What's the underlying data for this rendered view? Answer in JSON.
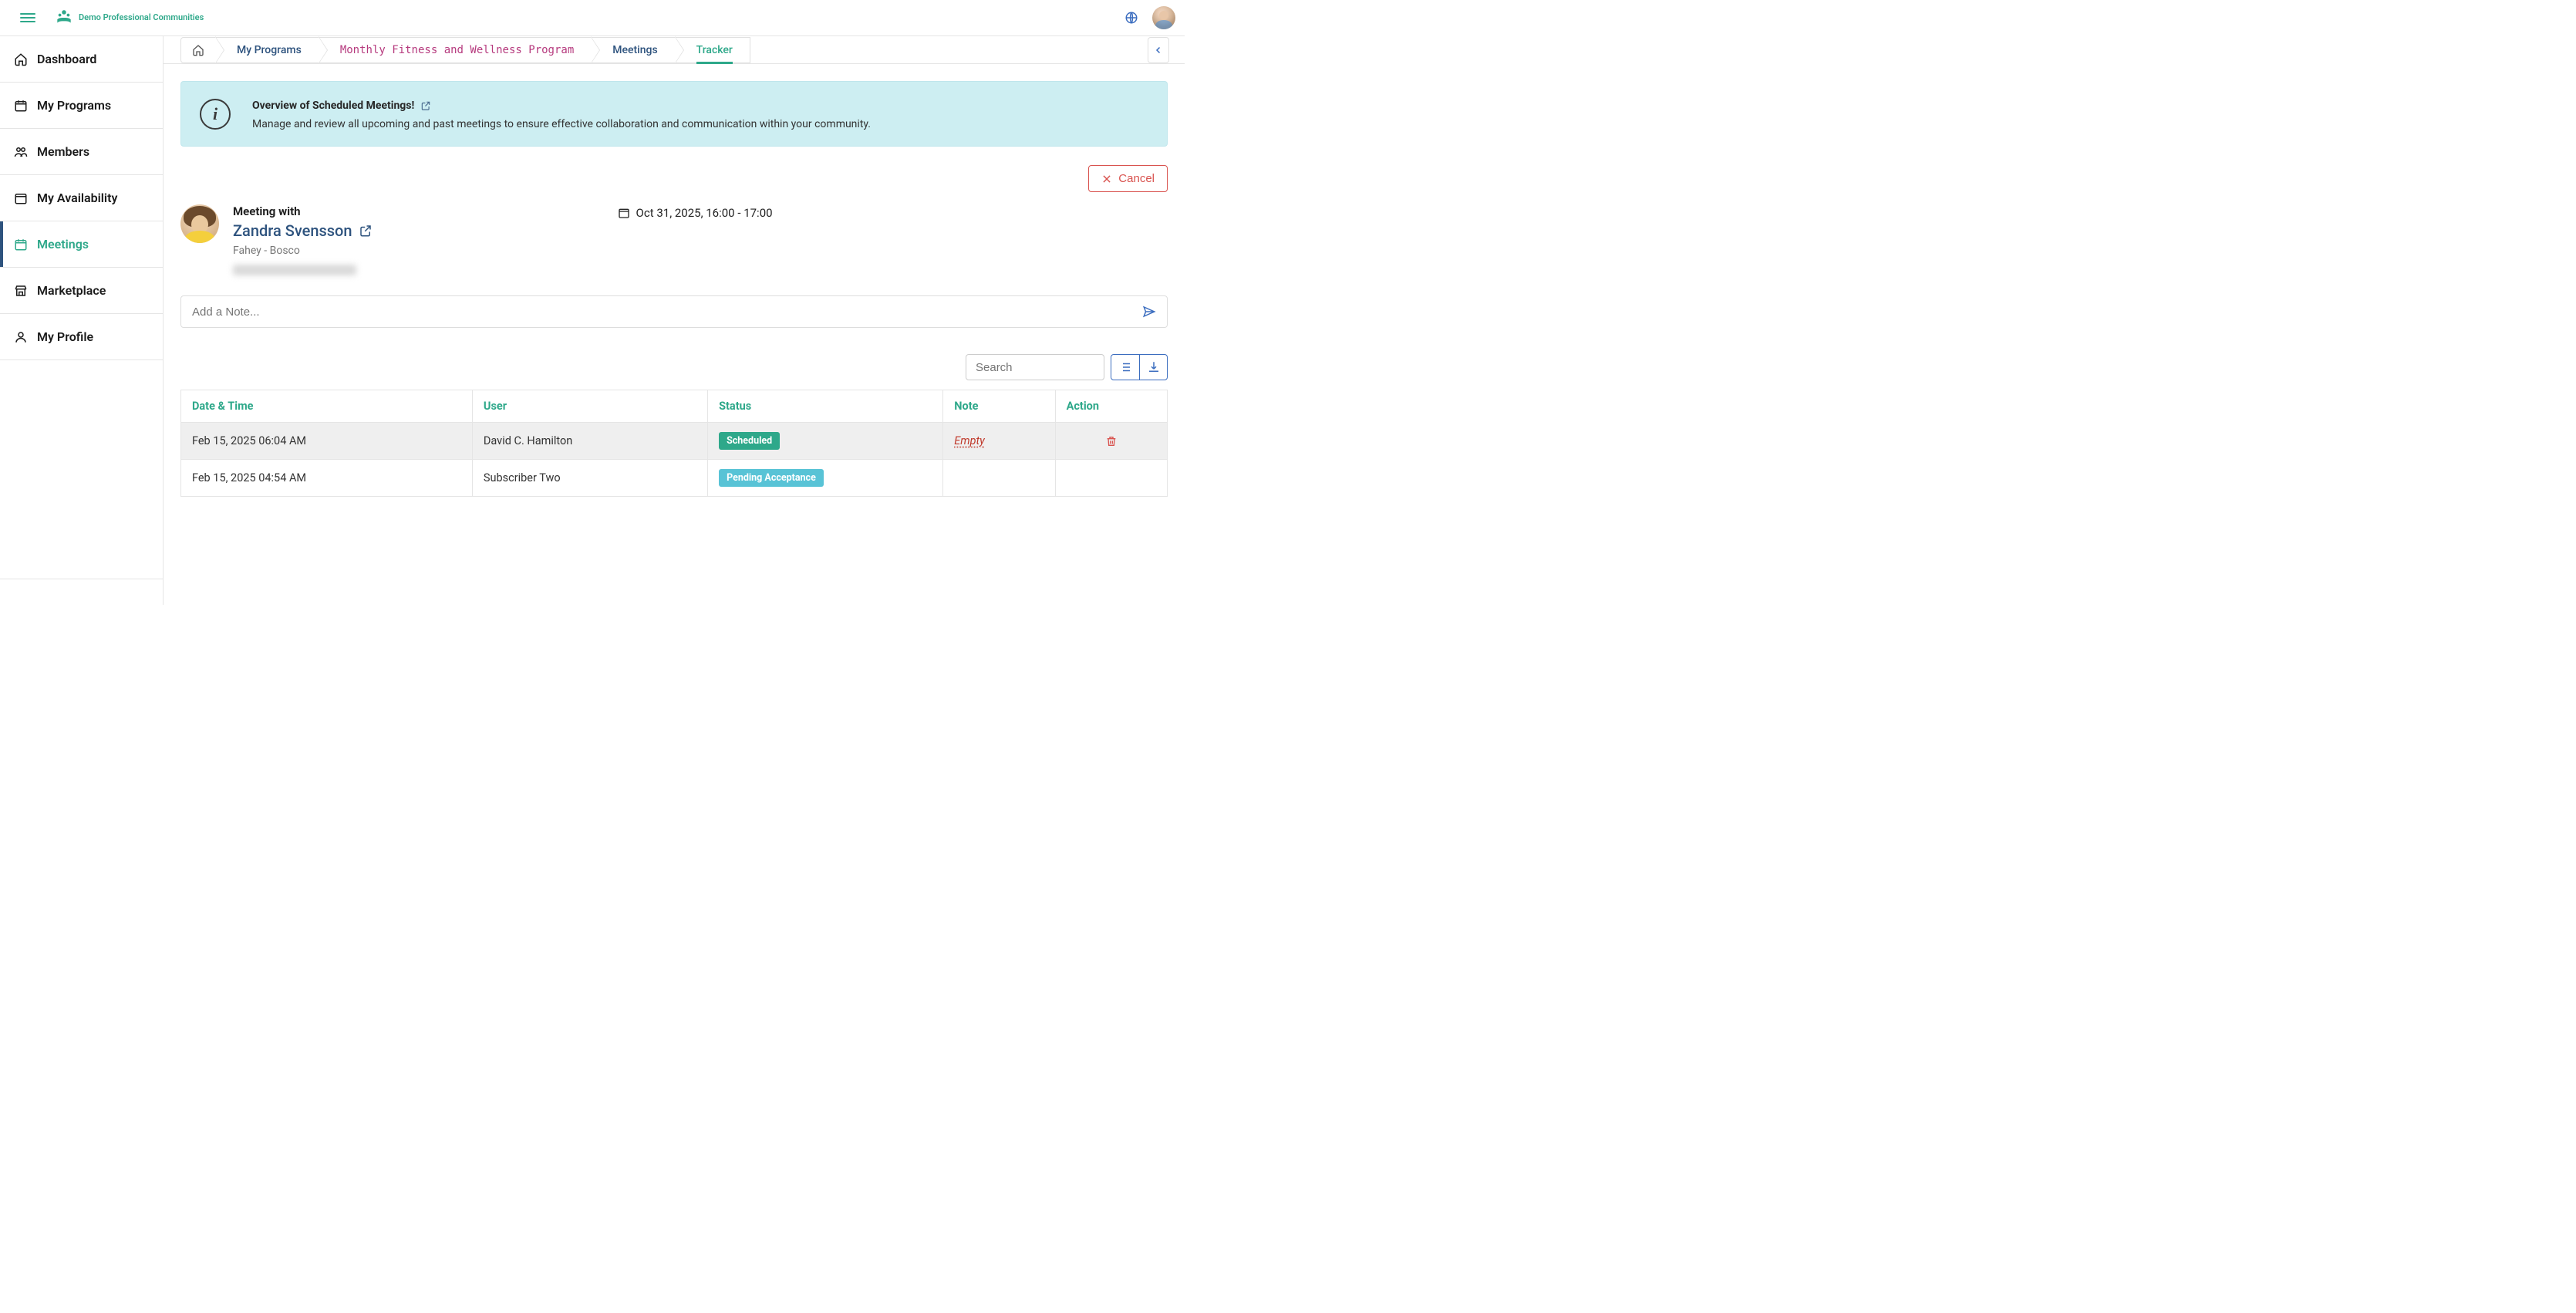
{
  "brand": {
    "name": "Demo Professional Communities"
  },
  "sidebar": {
    "items": [
      {
        "label": "Dashboard"
      },
      {
        "label": "My Programs"
      },
      {
        "label": "Members"
      },
      {
        "label": "My Availability"
      },
      {
        "label": "Meetings"
      },
      {
        "label": "Marketplace"
      },
      {
        "label": "My Profile"
      }
    ]
  },
  "breadcrumbs": {
    "items": [
      {
        "label": "My Programs"
      },
      {
        "label": "Monthly Fitness and Wellness Program"
      },
      {
        "label": "Meetings"
      },
      {
        "label": "Tracker"
      }
    ]
  },
  "banner": {
    "title": "Overview of Scheduled Meetings!",
    "desc": "Manage and review all upcoming and past meetings to ensure effective collaboration and communication within your community."
  },
  "actions": {
    "cancel": "Cancel"
  },
  "meeting": {
    "with_label": "Meeting with",
    "name": "Zandra Svensson",
    "org": "Fahey - Bosco",
    "date": "Oct 31, 2025, 16:00 - 17:00"
  },
  "note": {
    "placeholder": "Add a Note..."
  },
  "table": {
    "search_placeholder": "Search",
    "headers": {
      "datetime": "Date & Time",
      "user": "User",
      "status": "Status",
      "note": "Note",
      "action": "Action"
    },
    "rows": [
      {
        "datetime": "Feb 15, 2025 06:04 AM",
        "user": "David C. Hamilton",
        "status": "Scheduled",
        "status_class": "scheduled",
        "note": "Empty"
      },
      {
        "datetime": "Feb 15, 2025 04:54 AM",
        "user": "Subscriber Two",
        "status": "Pending Acceptance",
        "status_class": "pending",
        "note": ""
      }
    ]
  }
}
